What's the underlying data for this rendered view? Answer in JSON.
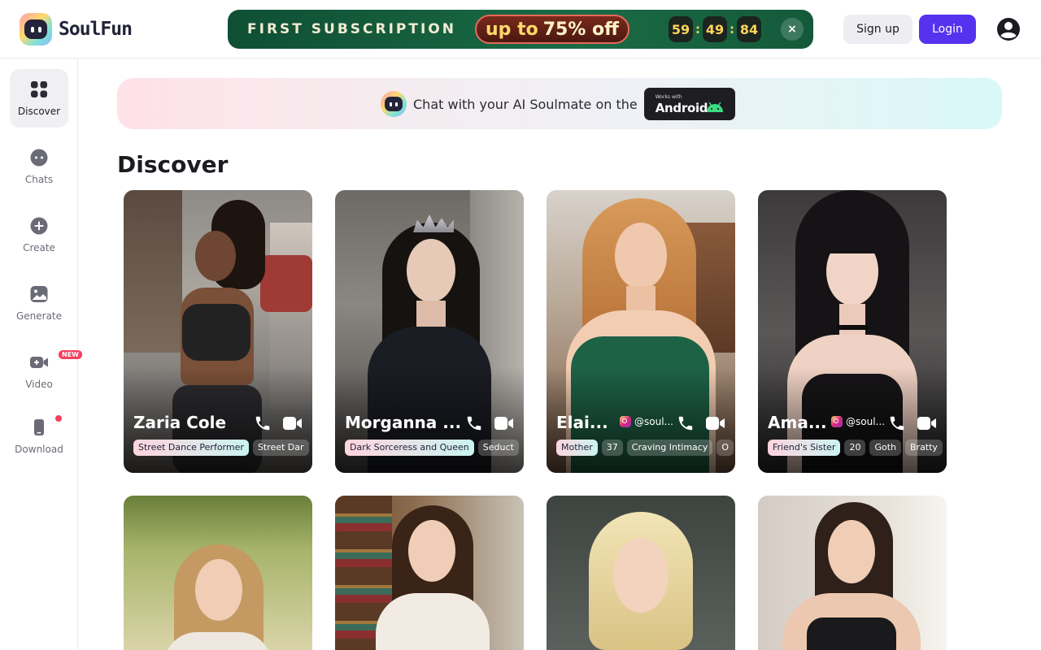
{
  "header": {
    "logo_text": "SoulFun",
    "promo": {
      "title": "FIRST SUBSCRIPTION",
      "up_to": "up to",
      "discount": "75% off",
      "timer": [
        "59",
        "49",
        "84"
      ],
      "close": "×"
    },
    "signup_label": "Sign up",
    "login_label": "Login"
  },
  "sidebar": {
    "items": [
      {
        "label": "Discover",
        "icon": "grid-icon"
      },
      {
        "label": "Chats",
        "icon": "chat-bubble-icon"
      },
      {
        "label": "Create",
        "icon": "plus-circle-icon"
      },
      {
        "label": "Generate",
        "icon": "image-icon"
      },
      {
        "label": "Video",
        "icon": "video-camera-icon",
        "badge": "NEW"
      },
      {
        "label": "Download",
        "icon": "phone-download-icon"
      }
    ]
  },
  "banner": {
    "text": "Chat with your AI Soulmate on the",
    "badge_small": "Works with",
    "badge_big": "Android"
  },
  "main": {
    "section_title": "Discover",
    "cards": [
      {
        "name": "Zaria Cole",
        "instagram": "",
        "tags": [
          "Street Dance Performer",
          "Street Dar"
        ]
      },
      {
        "name": "Morganna ...",
        "instagram": "",
        "tags": [
          "Dark Sorceress and Queen",
          "Seduct"
        ]
      },
      {
        "name": "Elai...",
        "instagram": "@soul...",
        "tags": [
          "Mother",
          "37",
          "Craving Intimacy",
          "O"
        ]
      },
      {
        "name": "Ama...",
        "instagram": "@soul...",
        "tags": [
          "Friend's Sister",
          "20",
          "Goth",
          "Bratty"
        ]
      },
      {
        "name": "",
        "instagram": "",
        "tags": []
      },
      {
        "name": "",
        "instagram": "",
        "tags": []
      },
      {
        "name": "",
        "instagram": "",
        "tags": []
      },
      {
        "name": "",
        "instagram": "",
        "tags": []
      }
    ]
  },
  "colors": {
    "accent": "#5533ee",
    "promo_bg": "#1a6a45",
    "badge_red": "#f43f5e"
  }
}
